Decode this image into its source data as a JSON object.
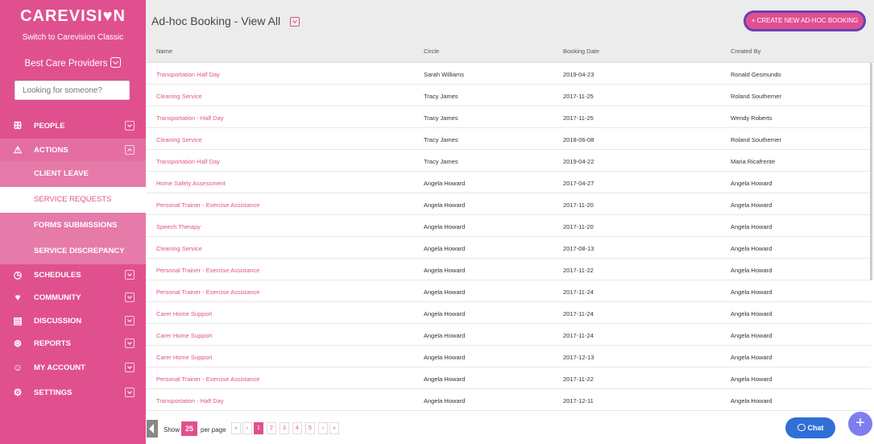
{
  "sidebar": {
    "logo_left": "CAREVISI",
    "logo_right": "N",
    "switch_link": "Switch to Carevision Classic",
    "provider": "Best Care Providers",
    "search_placeholder": "Looking for someone?",
    "nav": {
      "people": "PEOPLE",
      "actions": "ACTIONS",
      "client_leave": "CLIENT LEAVE",
      "service_requests": "SERVICE REQUESTS",
      "forms_submissions": "FORMS SUBMISSIONS",
      "service_discrepancy": "SERVICE DISCREPANCY",
      "schedules": "SCHEDULES",
      "community": "COMMUNITY",
      "discussion": "DISCUSSION",
      "reports": "REPORTS",
      "my_account": "MY ACCOUNT",
      "settings": "SETTINGS"
    }
  },
  "header": {
    "title": "Ad-hoc Booking - View All",
    "create_button": "+ CREATE NEW AD-HOC BOOKING"
  },
  "table": {
    "columns": [
      "Name",
      "Circle",
      "Booking Date",
      "Created By"
    ],
    "rows": [
      [
        "Transportation Half Day",
        "Sarah Williams",
        "2019-04-23",
        "Ronald Gesmundo"
      ],
      [
        "Cleaning Service",
        "Tracy James",
        "2017-11-25",
        "Roland Southerner"
      ],
      [
        "Transportation - Half Day",
        "Tracy James",
        "2017-11-25",
        "Wendy Roberts"
      ],
      [
        "Cleaning Service",
        "Tracy James",
        "2018-06-08",
        "Roland Southerner"
      ],
      [
        "Transportation Half Day",
        "Tracy James",
        "2019-04-22",
        "Maria Ricafrente"
      ],
      [
        "Home Safety Assessment",
        "Angela Howard",
        "2017-04-27",
        "Angela Howard"
      ],
      [
        "Personal Trainer - Exercise Assistance",
        "Angela Howard",
        "2017-11-20",
        "Angela Howard"
      ],
      [
        "Speech Therapy",
        "Angela Howard",
        "2017-11-20",
        "Angela Howard"
      ],
      [
        "Cleaning Service",
        "Angela Howard",
        "2017-08-13",
        "Angela Howard"
      ],
      [
        "Personal Trainer - Exercise Assistance",
        "Angela Howard",
        "2017-11-22",
        "Angela Howard"
      ],
      [
        "Personal Trainer - Exercise Assistance",
        "Angela Howard",
        "2017-11-24",
        "Angela Howard"
      ],
      [
        "Carer Home Support",
        "Angela Howard",
        "2017-11-24",
        "Angela Howard"
      ],
      [
        "Carer Home Support",
        "Angela Howard",
        "2017-11-24",
        "Angela Howard"
      ],
      [
        "Carer Home Support",
        "Angela Howard",
        "2017-12-13",
        "Angela Howard"
      ],
      [
        "Personal Trainer - Exercise Assistance",
        "Angela Howard",
        "2017-11-22",
        "Angela Howard"
      ],
      [
        "Transportation - Half Day",
        "Angela Howard",
        "2017-12-11",
        "Angela Howard"
      ]
    ]
  },
  "pager": {
    "show": "Show",
    "per_page_value": "25",
    "per_page": "per page",
    "first": "«",
    "prev": "‹",
    "pages": [
      "1",
      "2",
      "3",
      "4",
      "5"
    ],
    "next": "›",
    "last": "»"
  },
  "chat": {
    "label": "Chat"
  },
  "fab": {
    "label": "+"
  },
  "colors": {
    "brand": "#e0508f",
    "chat": "#2f6fd6",
    "fab": "#7e7ef0",
    "highlight": "#6a3fb8"
  }
}
